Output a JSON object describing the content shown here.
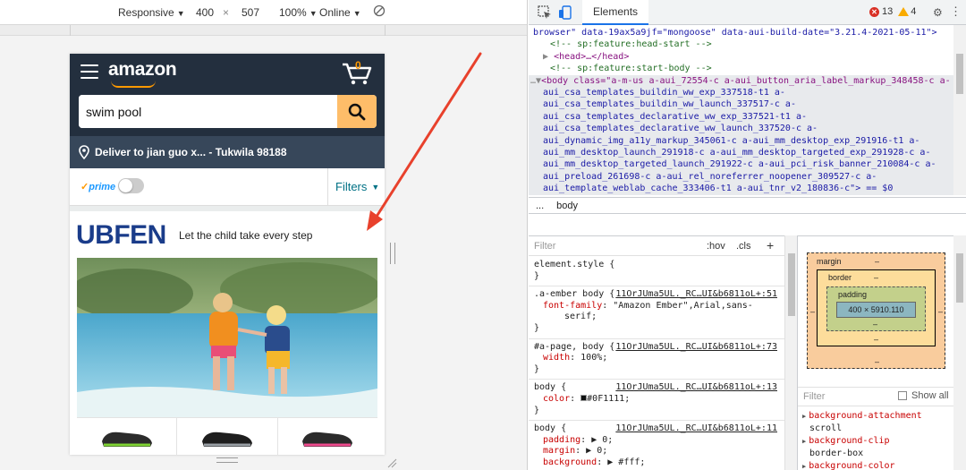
{
  "device_toolbar": {
    "device": "Responsive",
    "width": "400",
    "times": "×",
    "height": "507",
    "zoom": "100%",
    "network": "Online"
  },
  "amazon": {
    "logo": "amazon",
    "cart_count": "0",
    "search_value": "swim pool",
    "deliver_text": "Deliver to jian guo x... - Tukwila 98188",
    "prime_label": "prime",
    "filters_label": "Filters",
    "brand": "UBFEN",
    "tagline": "Let the child take every step"
  },
  "devtools": {
    "tab_elements": "Elements",
    "error_count": "13",
    "warning_count": "4",
    "dom_lines": [
      "browser\" data-19ax5a9jf=\"mongoose\" data-aui-build-date=\"3.21.4-2021-05-11\">",
      "<!-- sp:feature:head-start -->",
      "<head>…</head>",
      "<!-- sp:feature:start-body -->",
      "<body class=\"a-m-us a-aui_72554-c a-aui_button_aria_label_markup_348458-c a-",
      "aui_csa_templates_buildin_ww_exp_337518-t1 a-",
      "aui_csa_templates_buildin_ww_launch_337517-c a-",
      "aui_csa_templates_declarative_ww_exp_337521-t1 a-",
      "aui_csa_templates_declarative_ww_launch_337520-c a-",
      "aui_dynamic_img_a11y_markup_345061-c a-aui_mm_desktop_exp_291916-t1 a-",
      "aui_mm_desktop_launch_291918-c a-aui_mm_desktop_targeted_exp_291928-c a-",
      "aui_mm_desktop_targeted_launch_291922-c a-aui_pci_risk_banner_210084-c a-",
      "aui_preload_261698-c a-aui_rel_noreferrer_noopener_309527-c a-",
      "aui_template_weblab_cache_333406-t1 a-aui_tnr_v2_180836-c\"> == $0"
    ],
    "breadcrumb_dots": "...",
    "breadcrumb": "body",
    "styles_filter_placeholder": "Filter",
    "hov": ":hov",
    "cls": ".cls",
    "plus": "+",
    "rules": [
      {
        "selector": "element.style {",
        "source": "",
        "props": [],
        "close": "}"
      },
      {
        "selector": ".a-ember body {",
        "source": "11OrJUma5UL._RC…UI&b6811oL+:51",
        "props": [
          {
            "name": "font-family",
            "value": "\"Amazon Ember\",Arial,sans-"
          },
          {
            "name": "",
            "value": "serif;"
          }
        ],
        "close": "}"
      },
      {
        "selector": "#a-page, body {",
        "source": "11OrJUma5UL._RC…UI&b6811oL+:73",
        "props": [
          {
            "name": "width",
            "value": "100%;"
          }
        ],
        "close": "}"
      },
      {
        "selector": "body {",
        "source": "11OrJUma5UL._RC…UI&b6811oL+:13",
        "props": [
          {
            "name": "color",
            "value": "#0F1111;"
          }
        ],
        "close": "}"
      },
      {
        "selector": "body {",
        "source": "11OrJUma5UL._RC…UI&b6811oL+:11",
        "props": [
          {
            "name": "padding",
            "value": "▶ 0;"
          },
          {
            "name": "margin",
            "value": "▶ 0;"
          },
          {
            "name": "background",
            "value": "▶ #fff;"
          }
        ],
        "close": ""
      }
    ],
    "box_model": {
      "margin": "margin",
      "border": "border",
      "padding": "padding",
      "dash": "–",
      "content": "400 × 5910.110"
    },
    "computed_filter_placeholder": "Filter",
    "show_all": "Show all",
    "computed": [
      {
        "name": "background-attachment",
        "value": "scroll"
      },
      {
        "name": "background-clip",
        "value": "border-box"
      },
      {
        "name": "background-color",
        "value": ""
      }
    ]
  },
  "colors": {
    "amazon_dark": "#232f3e",
    "amazon_orange": "#ff9900",
    "search_button": "#febd69",
    "deliver_bar": "#37475a",
    "arrow": "#e8412c"
  }
}
